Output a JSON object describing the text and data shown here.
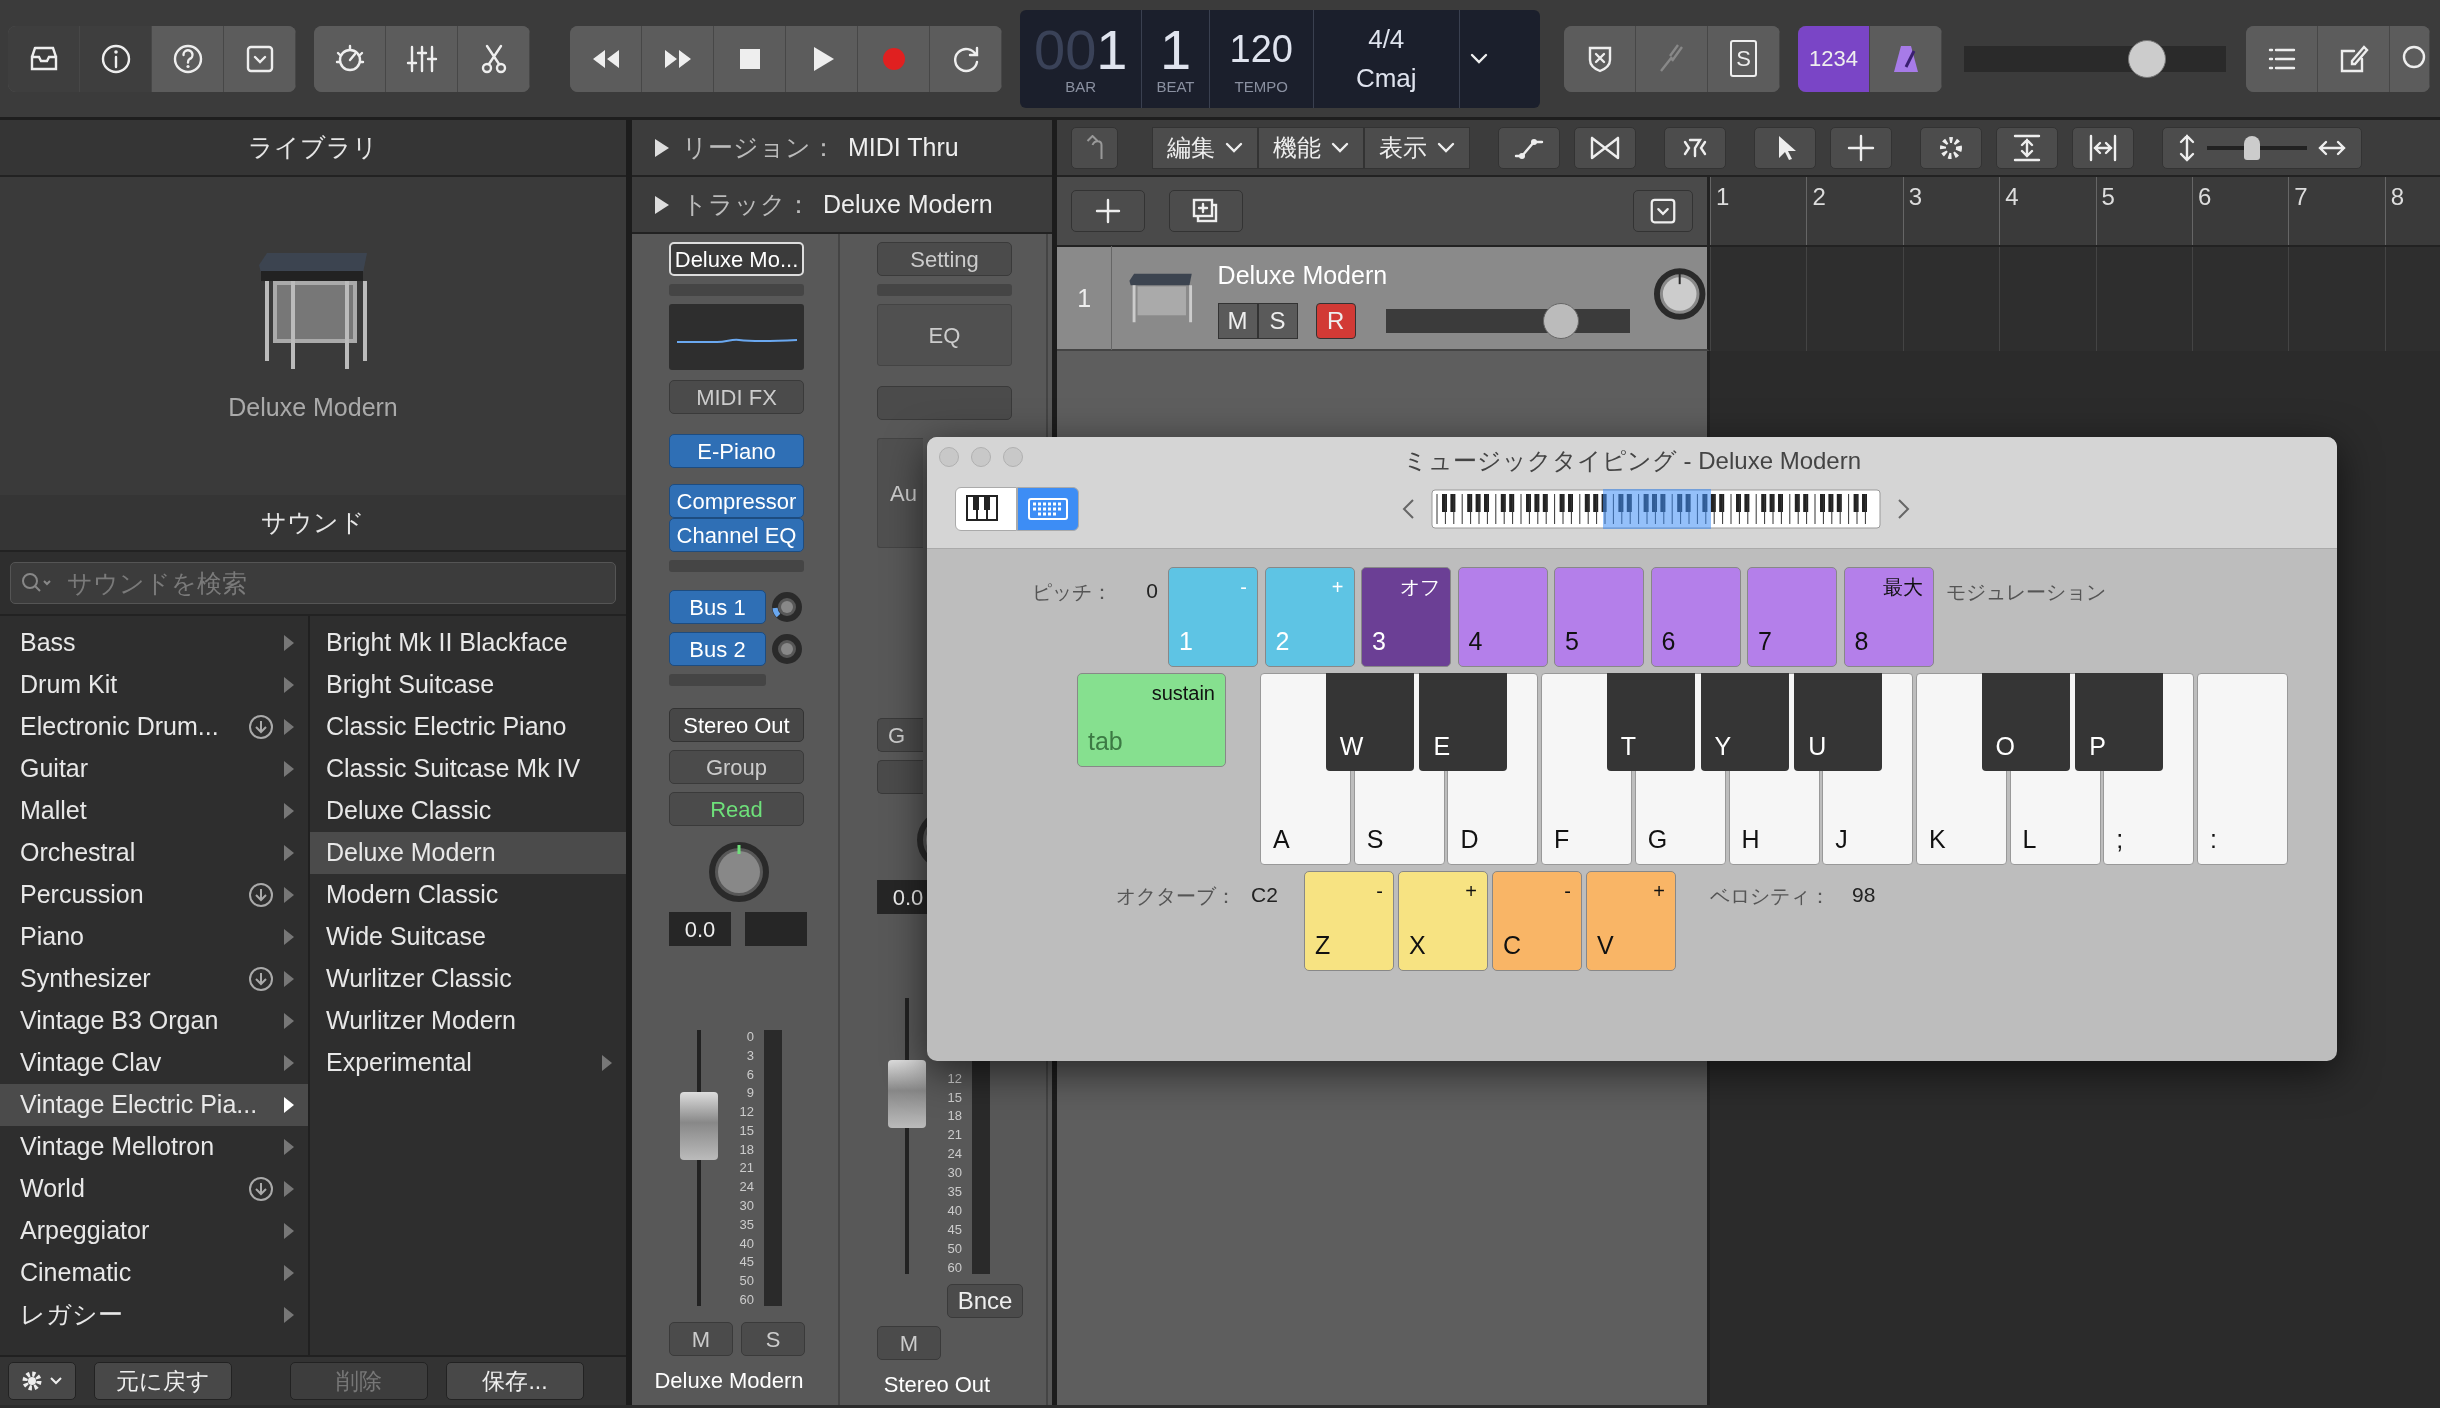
{
  "toolbar": {
    "view_toggles": [
      {
        "on": true
      },
      {
        "on": true
      },
      {
        "on": false
      },
      {
        "on": false
      }
    ],
    "lcd": {
      "bar_dim": "00",
      "bar": "1",
      "beat": "1",
      "bar_label": "BAR",
      "beat_label": "BEAT",
      "tempo": "120",
      "tempo_label": "TEMPO",
      "signature": "4/4",
      "key": "Cmaj"
    },
    "solo_button": "S",
    "count_in": {
      "label": "1234",
      "on": true
    },
    "metronome": {
      "on": true
    },
    "master_volume": {
      "level": 0.7
    }
  },
  "library": {
    "title": "ライブラリ",
    "preset_name": "Deluxe Modern",
    "sound_title": "サウンド",
    "search": {
      "placeholder": "サウンドを検索"
    },
    "categories": [
      {
        "label": "Bass",
        "download": false,
        "selected": false
      },
      {
        "label": "Drum Kit",
        "download": false,
        "selected": false
      },
      {
        "label": "Electronic Drum...",
        "download": true,
        "selected": false
      },
      {
        "label": "Guitar",
        "download": false,
        "selected": false
      },
      {
        "label": "Mallet",
        "download": false,
        "selected": false
      },
      {
        "label": "Orchestral",
        "download": false,
        "selected": false
      },
      {
        "label": "Percussion",
        "download": true,
        "selected": false
      },
      {
        "label": "Piano",
        "download": false,
        "selected": false
      },
      {
        "label": "Synthesizer",
        "download": true,
        "selected": false
      },
      {
        "label": "Vintage B3 Organ",
        "download": false,
        "selected": false
      },
      {
        "label": "Vintage Clav",
        "download": false,
        "selected": false
      },
      {
        "label": "Vintage Electric Pia...",
        "download": false,
        "selected": true
      },
      {
        "label": "Vintage Mellotron",
        "download": false,
        "selected": false
      },
      {
        "label": "World",
        "download": true,
        "selected": false
      },
      {
        "label": "Arpeggiator",
        "download": false,
        "selected": false
      },
      {
        "label": "Cinematic",
        "download": false,
        "selected": false
      },
      {
        "label": "レガシー",
        "download": false,
        "selected": false
      }
    ],
    "presets": [
      {
        "label": "Bright Mk II Blackface",
        "submenu": false,
        "selected": false
      },
      {
        "label": "Bright Suitcase",
        "submenu": false,
        "selected": false
      },
      {
        "label": "Classic Electric Piano",
        "submenu": false,
        "selected": false
      },
      {
        "label": "Classic Suitcase Mk IV",
        "submenu": false,
        "selected": false
      },
      {
        "label": "Deluxe Classic",
        "submenu": false,
        "selected": false
      },
      {
        "label": "Deluxe Modern",
        "submenu": false,
        "selected": true
      },
      {
        "label": "Modern Classic",
        "submenu": false,
        "selected": false
      },
      {
        "label": "Wide Suitcase",
        "submenu": false,
        "selected": false
      },
      {
        "label": "Wurlitzer Classic",
        "submenu": false,
        "selected": false
      },
      {
        "label": "Wurlitzer Modern",
        "submenu": false,
        "selected": false
      },
      {
        "label": "Experimental",
        "submenu": true,
        "selected": false
      }
    ],
    "buttons": [
      {
        "label": "元に戻す",
        "disabled": false
      },
      {
        "label": "削除",
        "disabled": true
      },
      {
        "label": "保存...",
        "disabled": false
      }
    ]
  },
  "inspector": {
    "region_label": "リージョン：",
    "region_value": "MIDI Thru",
    "track_label": "トラック：",
    "track_value": "Deluxe Modern",
    "strips": [
      {
        "kind": "instrument",
        "setting": "Deluxe Mo...",
        "midi_fx": "MIDI FX",
        "instrument": "E-Piano",
        "audio_fx": [
          "Compressor",
          "Channel EQ"
        ],
        "sends": [
          {
            "label": "Bus 1"
          },
          {
            "label": "Bus 2"
          }
        ],
        "output": "Stereo Out",
        "group": "Group",
        "automation": "Read",
        "pan_value": "0.0",
        "fader": {
          "level": 0.7
        },
        "scale": [
          "0",
          "3",
          "6",
          "9",
          "12",
          "15",
          "18",
          "21",
          "24",
          "30",
          "35",
          "40",
          "45",
          "50",
          "60"
        ],
        "mute": "M",
        "solo": "S",
        "name": "Deluxe Modern"
      },
      {
        "kind": "output",
        "setting": "Setting",
        "eq": "EQ",
        "audio_fx_partial": "Au",
        "group": "G",
        "pan_value": "0.0",
        "fader": {
          "level": 0.7
        },
        "scale": [
          "12",
          "15",
          "18",
          "21",
          "24",
          "30",
          "35",
          "40",
          "45",
          "50",
          "60"
        ],
        "bounce": "Bnce",
        "mute": "M",
        "name": "Stereo Out"
      }
    ]
  },
  "tracks": {
    "menus": [
      "編集",
      "機能",
      "表示"
    ],
    "zoom": {
      "level": 0.45
    },
    "ruler": [
      "1",
      "2",
      "3",
      "4",
      "5",
      "6",
      "7",
      "8"
    ],
    "track": {
      "number": "1",
      "name": "Deluxe Modern",
      "mute": "M",
      "solo": "S",
      "record": "R",
      "record_on": true,
      "volume": {
        "level": 0.72
      }
    }
  },
  "musical_typing": {
    "title": "ミュージックタイピング - Deluxe Modern",
    "input_modes": [
      {
        "selected": false
      },
      {
        "selected": true
      }
    ],
    "pitch_label": "ピッチ：",
    "pitch_value": "0",
    "modulation_label": "モジュレーション",
    "number_keys": [
      {
        "top": "-",
        "key": "1",
        "color": "#5ec4e4"
      },
      {
        "top": "+",
        "key": "2",
        "color": "#5ec4e4"
      },
      {
        "top": "オフ",
        "key": "3",
        "color": "#6b3f95"
      },
      {
        "key": "4",
        "color": "#b47fea"
      },
      {
        "key": "5",
        "color": "#b47fea"
      },
      {
        "key": "6",
        "color": "#b47fea"
      },
      {
        "key": "7",
        "color": "#b47fea"
      },
      {
        "top": "最大",
        "key": "8",
        "color": "#b47fea"
      }
    ],
    "sustain": {
      "top": "sustain",
      "key": "tab"
    },
    "white_keys": [
      {
        "key": "A",
        "black": "W"
      },
      {
        "key": "S",
        "black": "E"
      },
      {
        "key": "D"
      },
      {
        "key": "F",
        "black": "T"
      },
      {
        "key": "G",
        "black": "Y"
      },
      {
        "key": "H",
        "black": "U"
      },
      {
        "key": "J"
      },
      {
        "key": "K",
        "black": "O"
      },
      {
        "key": "L",
        "black": "P"
      },
      {
        "key": ";"
      },
      {
        "key": ":"
      }
    ],
    "octave_label": "オクターブ：",
    "octave_value": "C2",
    "octave_keys": [
      {
        "top": "-",
        "key": "Z",
        "color": "#f7e382"
      },
      {
        "top": "+",
        "key": "X",
        "color": "#f7e382"
      }
    ],
    "velocity_keys": [
      {
        "top": "-",
        "key": "C",
        "color": "#f9b566"
      },
      {
        "top": "+",
        "key": "V",
        "color": "#f9b566"
      }
    ],
    "velocity_label": "ベロシティ：",
    "velocity_value": "98"
  }
}
